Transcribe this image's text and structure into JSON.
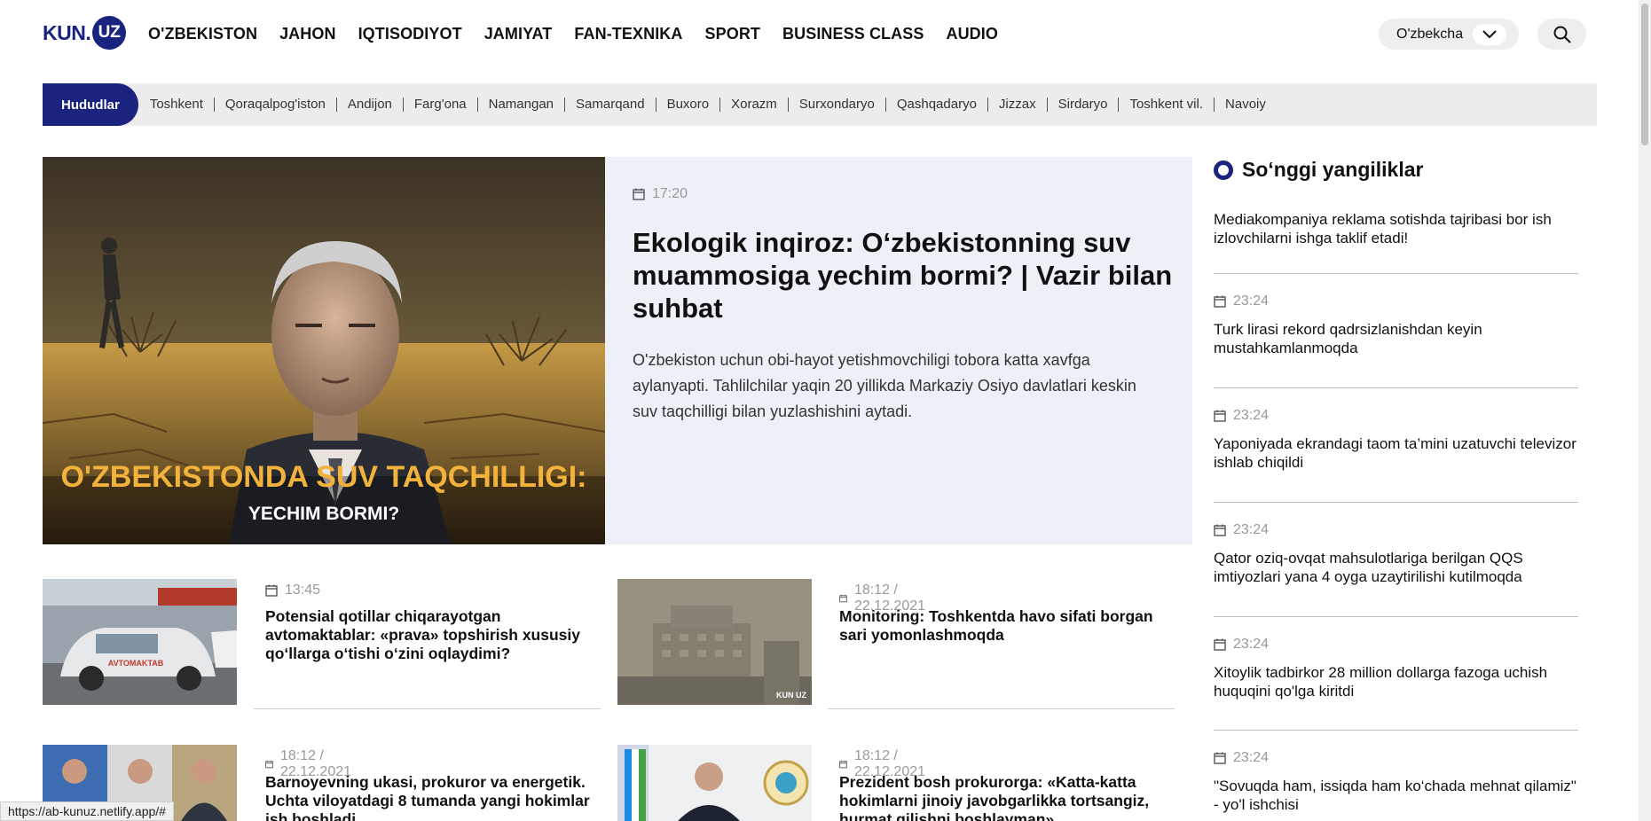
{
  "logo": {
    "kun": "KUN.",
    "uz": "UZ"
  },
  "nav": [
    "O'ZBEKISTON",
    "JAHON",
    "IQTISODIYOT",
    "JAMIYAT",
    "FAN-TEXNIKA",
    "SPORT",
    "BUSINESS CLASS",
    "AUDIO"
  ],
  "language": {
    "selected": "O'zbekcha"
  },
  "regions": {
    "active": "Hududlar",
    "items": [
      "Toshkent",
      "Qoraqalpog'iston",
      "Andijon",
      "Farg'ona",
      "Namangan",
      "Samarqand",
      "Buxoro",
      "Xorazm",
      "Surxondaryo",
      "Qashqadaryo",
      "Jizzax",
      "Sirdaryo",
      "Toshkent vil.",
      "Navoiy"
    ]
  },
  "hero": {
    "time": "17:20",
    "title": "Ekologik inqiroz: O‘zbekistonning suv muammosiga yechim bormi? | Vazir bilan suhbat",
    "description": "O'zbekiston uchun obi-hayot yetishmovchiligi tobora katta xavfga aylanyapti. Tahlilchilar yaqin 20 yillikda Markaziy Osiyo davlatlari keskin suv taqchilligi bilan yuzlashishini aytadi.",
    "image_caption_line1": "O'ZBEKISTONDA SUV TAQCHILLIGI:",
    "image_caption_line2": "YECHIM BORMI?"
  },
  "news": [
    {
      "time": "13:45",
      "title": "Potensial qotillar chiqarayotgan avtomaktablar: «prava» topshirish xususiy qo‘llarga o‘tishi o‘zini oqlaydimi?"
    },
    {
      "time": "18:12 / 22.12.2021",
      "title": "Monitoring: Toshkentda havo sifati borgan sari yomonlashmoqda"
    },
    {
      "time": "18:12 / 22.12.2021",
      "title": "Barnoyevning ukasi, prokuror va energetik. Uchta viloyatdagi 8 tumanda yangi hokimlar ish boshladi"
    },
    {
      "time": "18:12 / 22.12.2021",
      "title": "Prezident bosh prokurorga: «Katta-katta hokimlarni jinoiy javobgarlikka tortsangiz, hurmat qilishni boshlayman»"
    }
  ],
  "watermark": "KUN UZ",
  "sidebar": {
    "title": "So‘nggi yangiliklar",
    "first": "Mediakompaniya reklama sotishda tajribasi bor ish izlovchilarni ishga taklif etadi!",
    "items": [
      {
        "time": "23:24",
        "text": "Turk lirasi rekord qadrsizlanishdan keyin mustahkamlanmoqda"
      },
      {
        "time": "23:24",
        "text": "Yaponiyada ekrandagi taom ta’mini uzatuvchi televizor ishlab chiqildi"
      },
      {
        "time": "23:24",
        "text": "Qator oziq-ovqat mahsulotlariga berilgan QQS imtiyozlari yana 4 oyga uzaytirilishi kutilmoqda"
      },
      {
        "time": "23:24",
        "text": "Xitoylik tadbirkor 28 million dollarga fazoga uchish huquqini qo'lga kiritdi"
      },
      {
        "time": "23:24",
        "text": "\"Sovuqda ham, issiqda ham ko‘chada mehnat qilamiz\" - yo'l ishchisi"
      }
    ]
  },
  "status_url": "https://ab-kunuz.netlify.app/#",
  "colors": {
    "brand": "#1a237e",
    "hero_bg": "#eef0f8",
    "regions_bg": "#ececec"
  }
}
